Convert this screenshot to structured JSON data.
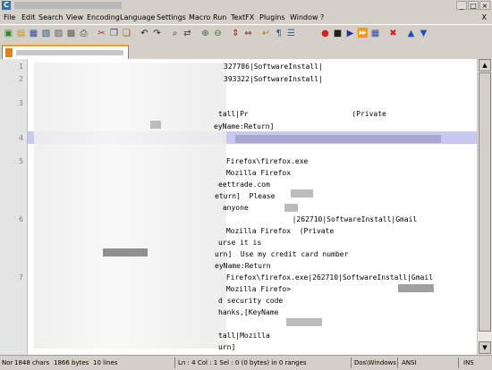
{
  "window": {
    "icon_letter": "C"
  },
  "menu": {
    "items": [
      "File",
      "Edit",
      "Search",
      "View",
      "Encoding",
      "Language",
      "Settings",
      "Macro",
      "Run",
      "TextFX",
      "Plugins",
      "Window",
      "?"
    ],
    "close_label": "X"
  },
  "toolbar": {
    "icons": [
      "new-file-icon",
      "open-file-icon",
      "save-icon",
      "save-all-icon",
      "close-file-icon",
      "close-all-icon",
      "print-icon",
      "cut-icon",
      "copy-icon",
      "paste-icon",
      "undo-icon",
      "redo-icon",
      "find-icon",
      "replace-icon",
      "zoom-in-icon",
      "zoom-out-icon",
      "sync-v-icon",
      "sync-h-icon",
      "wrap-icon",
      "all-chars-icon",
      "indent-guide-icon",
      "record-macro-icon",
      "stop-macro-icon",
      "play-macro-icon",
      "run-macro-multiple-icon",
      "save-macro-icon",
      "trim-icon",
      "scroll-up-icon",
      "scroll-down-icon"
    ]
  },
  "editor": {
    "line_numbers": [
      "1",
      "2",
      "3",
      "4",
      "5",
      "6",
      "7"
    ],
    "lines": [
      "327786|SoftwareInstall|",
      "393322|SoftwareInstall|",
      "tall|Pr                        (Private",
      "eyName:Return]",
      "                                     ",
      " Firefox\\firefox.exe",
      " Mozilla Firefox",
      "eettrade.com",
      "eturn]  Please",
      " anyone",
      "             |262710|SoftwareInstall|Gmail",
      " Mozilla Firefox  (Private",
      "urse it is",
      "urn]  Use my credit card number",
      "eyName:Return",
      " Firefox\\firefox.exe|262710|SoftwareInstall|Gmail",
      " Mozilla Firefo>",
      "d security code",
      "hanks,[KeyName",
      "tall|Mozilla",
      "urn]"
    ]
  },
  "statusbar": {
    "type": "Nor",
    "chars": "1848 chars",
    "bytes": "1866 bytes",
    "lines": "10 lines",
    "position": "Ln : 4   Col : 1   Sel : 0 (0 bytes) in 0 ranges",
    "eol": "Dos\\Windows",
    "encoding": "ANSI",
    "mode": "INS"
  }
}
